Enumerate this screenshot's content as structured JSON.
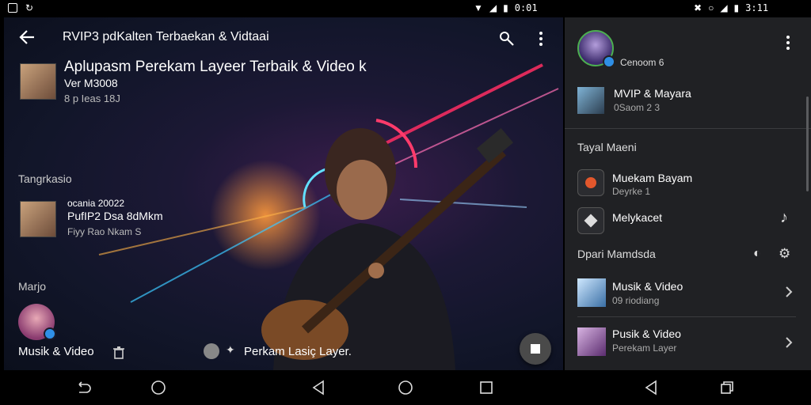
{
  "status_bar": {
    "left_time": "0:01",
    "right_time": "3:11"
  },
  "app_bar": {
    "title": "RVIP3 pdKalten Terbaekan & Vidtaai"
  },
  "hero": {
    "heading": "Aplupasm Perekam Layeer Terbaik & Video  k",
    "meta_line1": "Ver M3008",
    "meta_line2": "8 p  Ieas  18J"
  },
  "section_tangrkasio": {
    "label": "Tangrkasio",
    "card": {
      "date": "ocania 20022",
      "title": "PufIP2 Dsa 8dMkm",
      "subtitle": "Fiyy  Rao  Nkam  S"
    }
  },
  "section_marjo": {
    "label": "Marjo"
  },
  "bottom": {
    "musik_label": "Musik & Video",
    "record_label": "Perkam Lasiç Layer."
  },
  "side_panel": {
    "profile_name": "Cenoom 6",
    "featured": {
      "title": "MVIP & Mayara",
      "subtitle": "0Saom 2 3"
    },
    "section1": "Tayal Maeni",
    "items1": [
      {
        "title": "Muekam Bayam",
        "subtitle": "Deyrke 1"
      },
      {
        "title": "Melykacet",
        "subtitle": ""
      }
    ],
    "section2": "Dpari Mamdsda",
    "items2": [
      {
        "title": "Musik & Video",
        "subtitle": "09 riodiang"
      },
      {
        "title": "Pusik & Video",
        "subtitle": "Perekam Layer"
      }
    ]
  },
  "colors": {
    "panel_bg": "#202124",
    "accent_green": "#4caf50",
    "badge_blue": "#2f8fe6"
  }
}
